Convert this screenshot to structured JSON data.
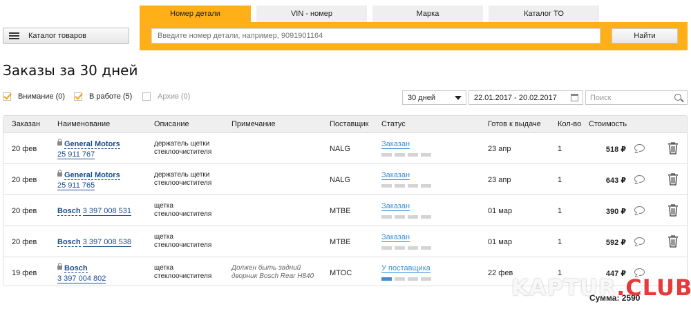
{
  "catalog_button": {
    "label": "Каталог товаров"
  },
  "search": {
    "tabs": [
      {
        "label": "Номер детали",
        "active": true
      },
      {
        "label": "VIN - номер",
        "active": false
      },
      {
        "label": "Марка",
        "active": false
      },
      {
        "label": "Каталог ТО",
        "active": false
      }
    ],
    "placeholder": "Введите номер детали, например, 9091901164",
    "button_label": "Найти"
  },
  "page_title": "Заказы за 30 дней",
  "filters": {
    "attention": {
      "label": "Внимание (0)",
      "checked": true
    },
    "in_work": {
      "label": "В работе (5)",
      "checked": true
    },
    "archive": {
      "label": "Архив (0)",
      "checked": false
    },
    "period": "30 дней",
    "date_range": "22.01.2017 - 20.02.2017",
    "search_placeholder": "Поиск"
  },
  "table": {
    "columns": {
      "date": "Заказан",
      "name": "Наименование",
      "description": "Описание",
      "note": "Примечание",
      "supplier": "Поставщик",
      "status": "Статус",
      "ready": "Готов к выдаче",
      "qty": "Кол-во",
      "cost": "Стоимость"
    },
    "rows": [
      {
        "date": "20 фев",
        "brand": "General Motors",
        "article": "25 911 767",
        "locked": true,
        "description": "держатель щетки стеклоочистителя",
        "note": "",
        "supplier": "NALG",
        "status": "Заказан",
        "progress": 0,
        "ready": "23 апр",
        "qty": "1",
        "cost": "518 ₽"
      },
      {
        "date": "20 фев",
        "brand": "General Motors",
        "article": "25 911 765",
        "locked": true,
        "description": "держатель щетки стеклоочистителя",
        "note": "",
        "supplier": "NALG",
        "status": "Заказан",
        "progress": 0,
        "ready": "23 апр",
        "qty": "1",
        "cost": "643 ₽"
      },
      {
        "date": "20 фев",
        "brand": "Bosch",
        "article": "3 397 008 531",
        "locked": false,
        "description": "щетка стеклоочистителя",
        "note": "",
        "supplier": "MTBE",
        "status": "Заказан",
        "progress": 0,
        "ready": "01 мар",
        "qty": "1",
        "cost": "390 ₽"
      },
      {
        "date": "20 фев",
        "brand": "Bosch",
        "article": "3 397 008 538",
        "locked": false,
        "description": "щетка стеклоочистителя",
        "note": "",
        "supplier": "MTBE",
        "status": "Заказан",
        "progress": 0,
        "ready": "01 мар",
        "qty": "1",
        "cost": "592 ₽"
      },
      {
        "date": "19 фев",
        "brand": "Bosch",
        "article": "3 397 004 802",
        "locked": true,
        "description": "щетка стеклоочистителя",
        "note": "Должен быть задний дворник Bosch Rear H840",
        "supplier": "MTOC",
        "status": "У поставщика",
        "progress": 1,
        "ready": "22 фев",
        "qty": "1",
        "cost": "447 ₽"
      }
    ]
  },
  "sum": "Сумма: 2590",
  "watermark": {
    "main": "KAPTUR",
    "accent": ".CLUB"
  },
  "colors": {
    "accent": "#ffb019",
    "link": "#1b4c8f",
    "status": "#3d8fd1"
  }
}
